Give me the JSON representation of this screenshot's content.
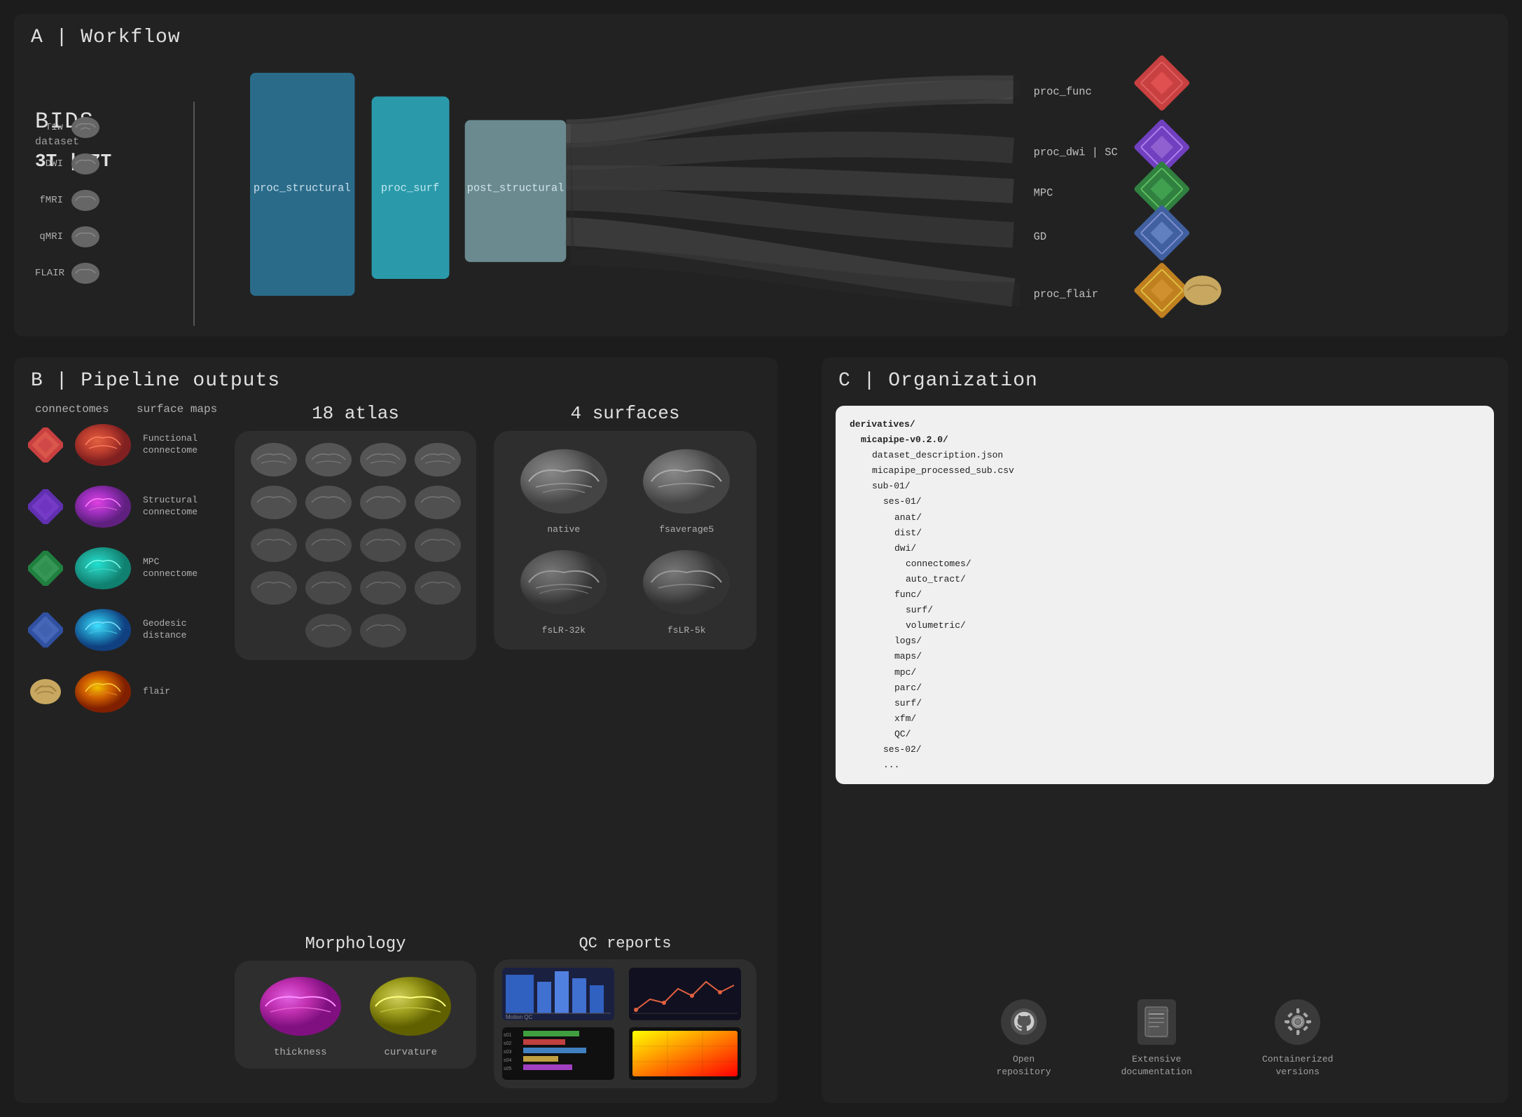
{
  "sections": {
    "a": {
      "title": "A | Workflow",
      "bids": {
        "label": "BIDS",
        "dataset": "dataset",
        "field_strength": "3T | 7T",
        "inputs": [
          {
            "label": "T1w"
          },
          {
            "label": "DWI"
          },
          {
            "label": "fMRI"
          },
          {
            "label": "qMRI"
          },
          {
            "label": "FLAIR"
          }
        ]
      },
      "pipeline": {
        "proc_structural": "proc_structural",
        "proc_surf": "proc_surf",
        "post_structural": "post_structural"
      },
      "outputs": [
        {
          "label": "proc_func",
          "color": "red"
        },
        {
          "label": "proc_dwi | SC",
          "color": "purple"
        },
        {
          "label": "MPC",
          "color": "green"
        },
        {
          "label": "GD",
          "color": "blue"
        },
        {
          "label": "proc_flair",
          "color": "yellow"
        }
      ]
    },
    "b": {
      "title": "B | Pipeline outputs",
      "connectomes_label": "connectomes",
      "surface_maps_label": "surface maps",
      "connectomes": [
        {
          "label": "Functional\nconnectome",
          "color": "red"
        },
        {
          "label": "Structural\nconnectome",
          "color": "purple"
        },
        {
          "label": "MPC\nconnectome",
          "color": "green"
        },
        {
          "label": "Geodesic\ndistance",
          "color": "blue"
        },
        {
          "label": "flair",
          "color": "yellow"
        }
      ],
      "atlas": {
        "title": "18 atlas",
        "count": 18
      },
      "surfaces": {
        "title": "4 surfaces",
        "items": [
          {
            "label": "native"
          },
          {
            "label": "fsaverage5"
          },
          {
            "label": "fsLR-32k"
          },
          {
            "label": "fsLR-5k"
          }
        ]
      },
      "morphology": {
        "title": "Morphology",
        "items": [
          {
            "label": "thickness"
          },
          {
            "label": "curvature"
          }
        ]
      },
      "qc": {
        "title": "QC  reports"
      }
    },
    "c": {
      "title": "C | Organization",
      "code": "derivatives/\n  micapipe-v0.2.0/\n    dataset_description.json\n    micapipe_processed_sub.csv\n    sub-01/\n      ses-01/\n        anat/\n        dist/\n        dwi/\n          connectomes/\n          auto_tract/\n        func/\n          surf/\n          volumetric/\n        logs/\n        maps/\n        mpc/\n        parc/\n        surf/\n        xfm/\n        QC/\n      ses-02/\n      ...",
      "icons": [
        {
          "label": "Open\nrepository",
          "icon": "github"
        },
        {
          "label": "Extensive\ndocumentation",
          "icon": "docs"
        },
        {
          "label": "Containerized\nversions",
          "icon": "gear"
        }
      ]
    }
  }
}
